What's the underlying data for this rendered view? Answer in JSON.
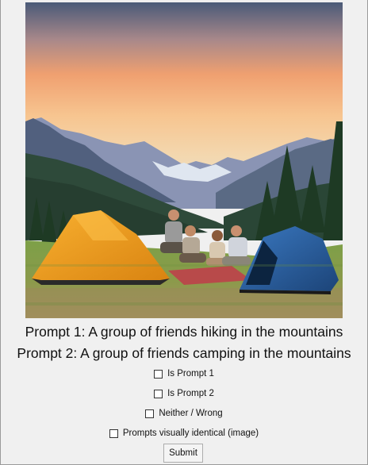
{
  "image": {
    "alt_subject": "campsite-photo"
  },
  "prompts": {
    "prompt_1": "Prompt 1: A group of friends hiking in the mountains",
    "prompt_2": "Prompt 2: A group of friends camping in the mountains"
  },
  "checkboxes": [
    {
      "label": "Is Prompt 1",
      "checked": false
    },
    {
      "label": "Is Prompt 2",
      "checked": false
    },
    {
      "label": "Neither / Wrong",
      "checked": false
    },
    {
      "label": "Prompts visually identical (image)",
      "checked": false
    }
  ],
  "submit": {
    "label": "Submit"
  },
  "colors": {
    "window_bg": "#f0f0f0",
    "tent_orange": "#f0a020",
    "tent_blue": "#2a5a9a"
  }
}
